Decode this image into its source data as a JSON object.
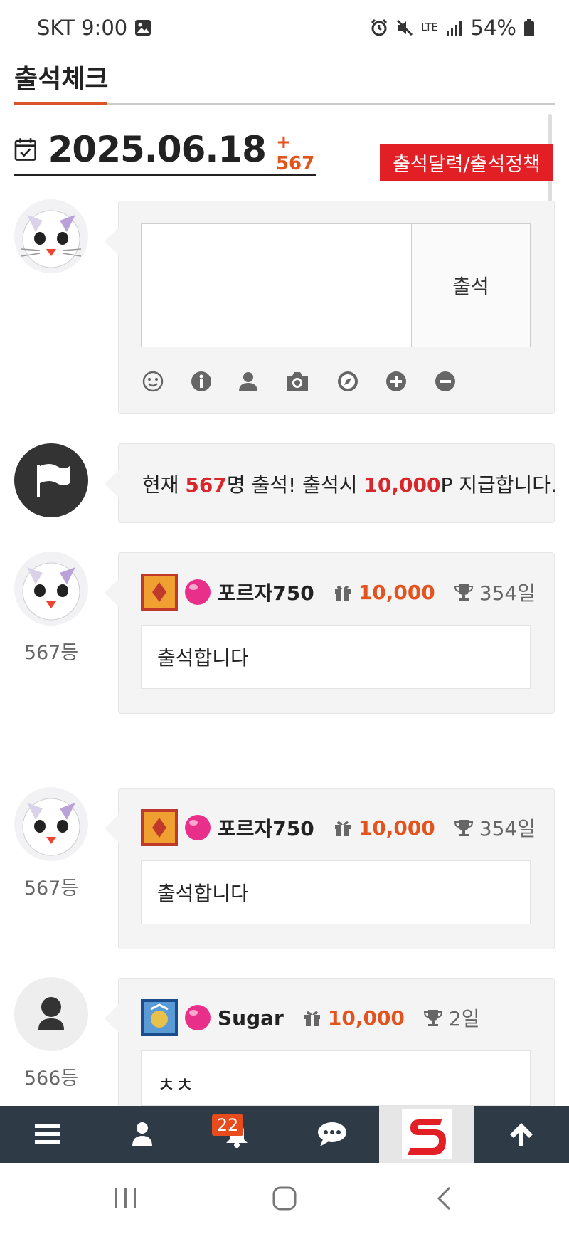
{
  "status_bar": {
    "carrier_time": "SKT 9:00",
    "network": "LTE",
    "battery": "54%"
  },
  "page": {
    "title": "출석체크"
  },
  "date_header": {
    "date": "2025.06.18",
    "count": "+ 567",
    "policy_button": "출석달력/출석정책"
  },
  "composer": {
    "submit_label": "출석"
  },
  "notice": {
    "prefix": "현재 ",
    "count": "567",
    "mid": "명 출석! 출석시 ",
    "points": "10,000",
    "suffix": "P 지급합니다."
  },
  "entries": [
    {
      "rank": "567등",
      "nickname": "포르자750",
      "gift": "10,000",
      "days": "354일",
      "comment": "출석합니다"
    },
    {
      "rank": "567등",
      "nickname": "포르자750",
      "gift": "10,000",
      "days": "354일",
      "comment": "출석합니다"
    },
    {
      "rank": "566등",
      "nickname": "Sugar",
      "gift": "10,000",
      "days": "2일",
      "comment": "ㅊㅊ"
    }
  ],
  "bottom_nav": {
    "notification_count": "22"
  },
  "colors": {
    "accent_red": "#e21f24",
    "accent_orange": "#e2531e",
    "nav_bg": "#2f3a47"
  }
}
